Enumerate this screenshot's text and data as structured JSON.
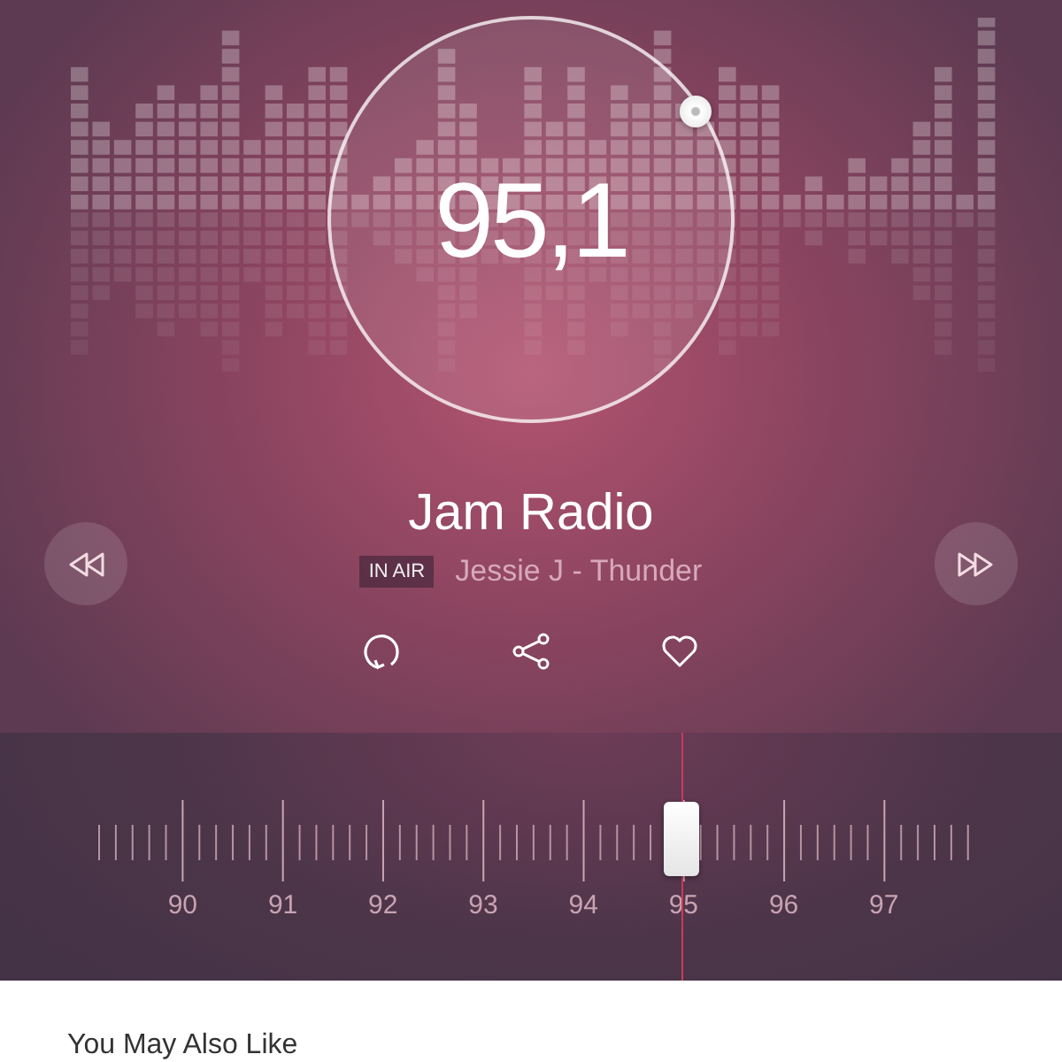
{
  "station": {
    "frequency": "95,1",
    "name": "Jam Radio",
    "badge": "IN AIR",
    "track": "Jessie J - Thunder"
  },
  "actions": [
    {
      "kind": "repeat"
    },
    {
      "kind": "share"
    },
    {
      "kind": "favorite"
    }
  ],
  "tuner": {
    "level": 0.67,
    "labels": [
      "90",
      "91",
      "92",
      "93",
      "94",
      "95",
      "96",
      "97"
    ]
  },
  "section": {
    "title": "You May Also Like"
  }
}
